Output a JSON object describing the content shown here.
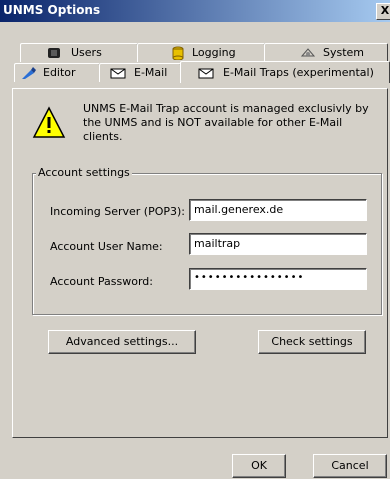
{
  "window": {
    "title": "UNMS Options",
    "close_label": "X"
  },
  "tabs_row1": [
    {
      "label": "Users",
      "icon": "users-icon"
    },
    {
      "label": "Logging",
      "icon": "database-icon"
    },
    {
      "label": "System",
      "icon": "network-icon"
    }
  ],
  "tabs_row2": [
    {
      "label": "Editor",
      "icon": "editor-icon"
    },
    {
      "label": "E-Mail",
      "icon": "email-icon"
    },
    {
      "label": "E-Mail Traps (experimental)",
      "icon": "email-trap-icon",
      "active": true
    }
  ],
  "notice": {
    "line1": "UNMS E-Mail Trap account is managed exclusivly by",
    "line2": "the UNMS and is NOT available for other E-Mail",
    "line3": "clients."
  },
  "account": {
    "legend": "Account settings",
    "server_label": "Incoming Server (POP3):",
    "server_value": "mail.generex.de",
    "user_label": "Account User Name:",
    "user_value": "mailtrap",
    "password_label": "Account Password:",
    "password_value": "••••••••••••••••"
  },
  "buttons": {
    "advanced": "Advanced settings...",
    "check": "Check settings",
    "ok": "OK",
    "cancel": "Cancel"
  },
  "colors": {
    "titlebar_start": "#0a246a",
    "titlebar_end": "#a6caf0",
    "face": "#d4d0c8"
  }
}
